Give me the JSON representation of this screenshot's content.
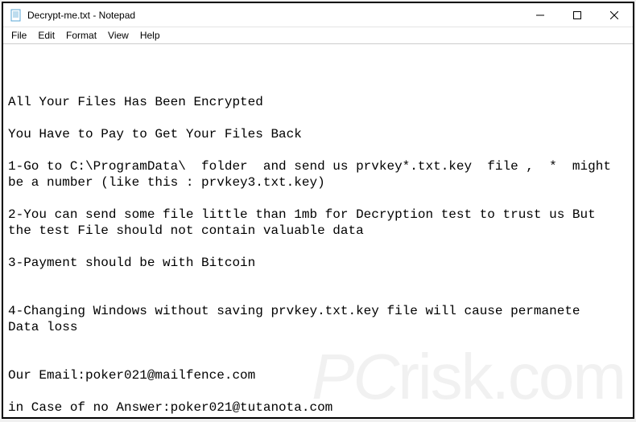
{
  "titlebar": {
    "title": "Decrypt-me.txt - Notepad"
  },
  "menu": {
    "file": "File",
    "edit": "Edit",
    "format": "Format",
    "view": "View",
    "help": "Help"
  },
  "content": {
    "text": "All Your Files Has Been Encrypted\n\nYou Have to Pay to Get Your Files Back\n\n1-Go to C:\\ProgramData\\  folder  and send us prvkey*.txt.key  file ,  *  might\nbe a number (like this : prvkey3.txt.key)\n\n2-You can send some file little than 1mb for Decryption test to trust us But\nthe test File should not contain valuable data\n\n3-Payment should be with Bitcoin\n\n\n4-Changing Windows without saving prvkey.txt.key file will cause permanete\nData loss\n\n\nOur Email:poker021@mailfence.com\n\nin Case of no Answer:poker021@tutanota.com"
  },
  "watermark": {
    "text": "PCrisk.com"
  }
}
